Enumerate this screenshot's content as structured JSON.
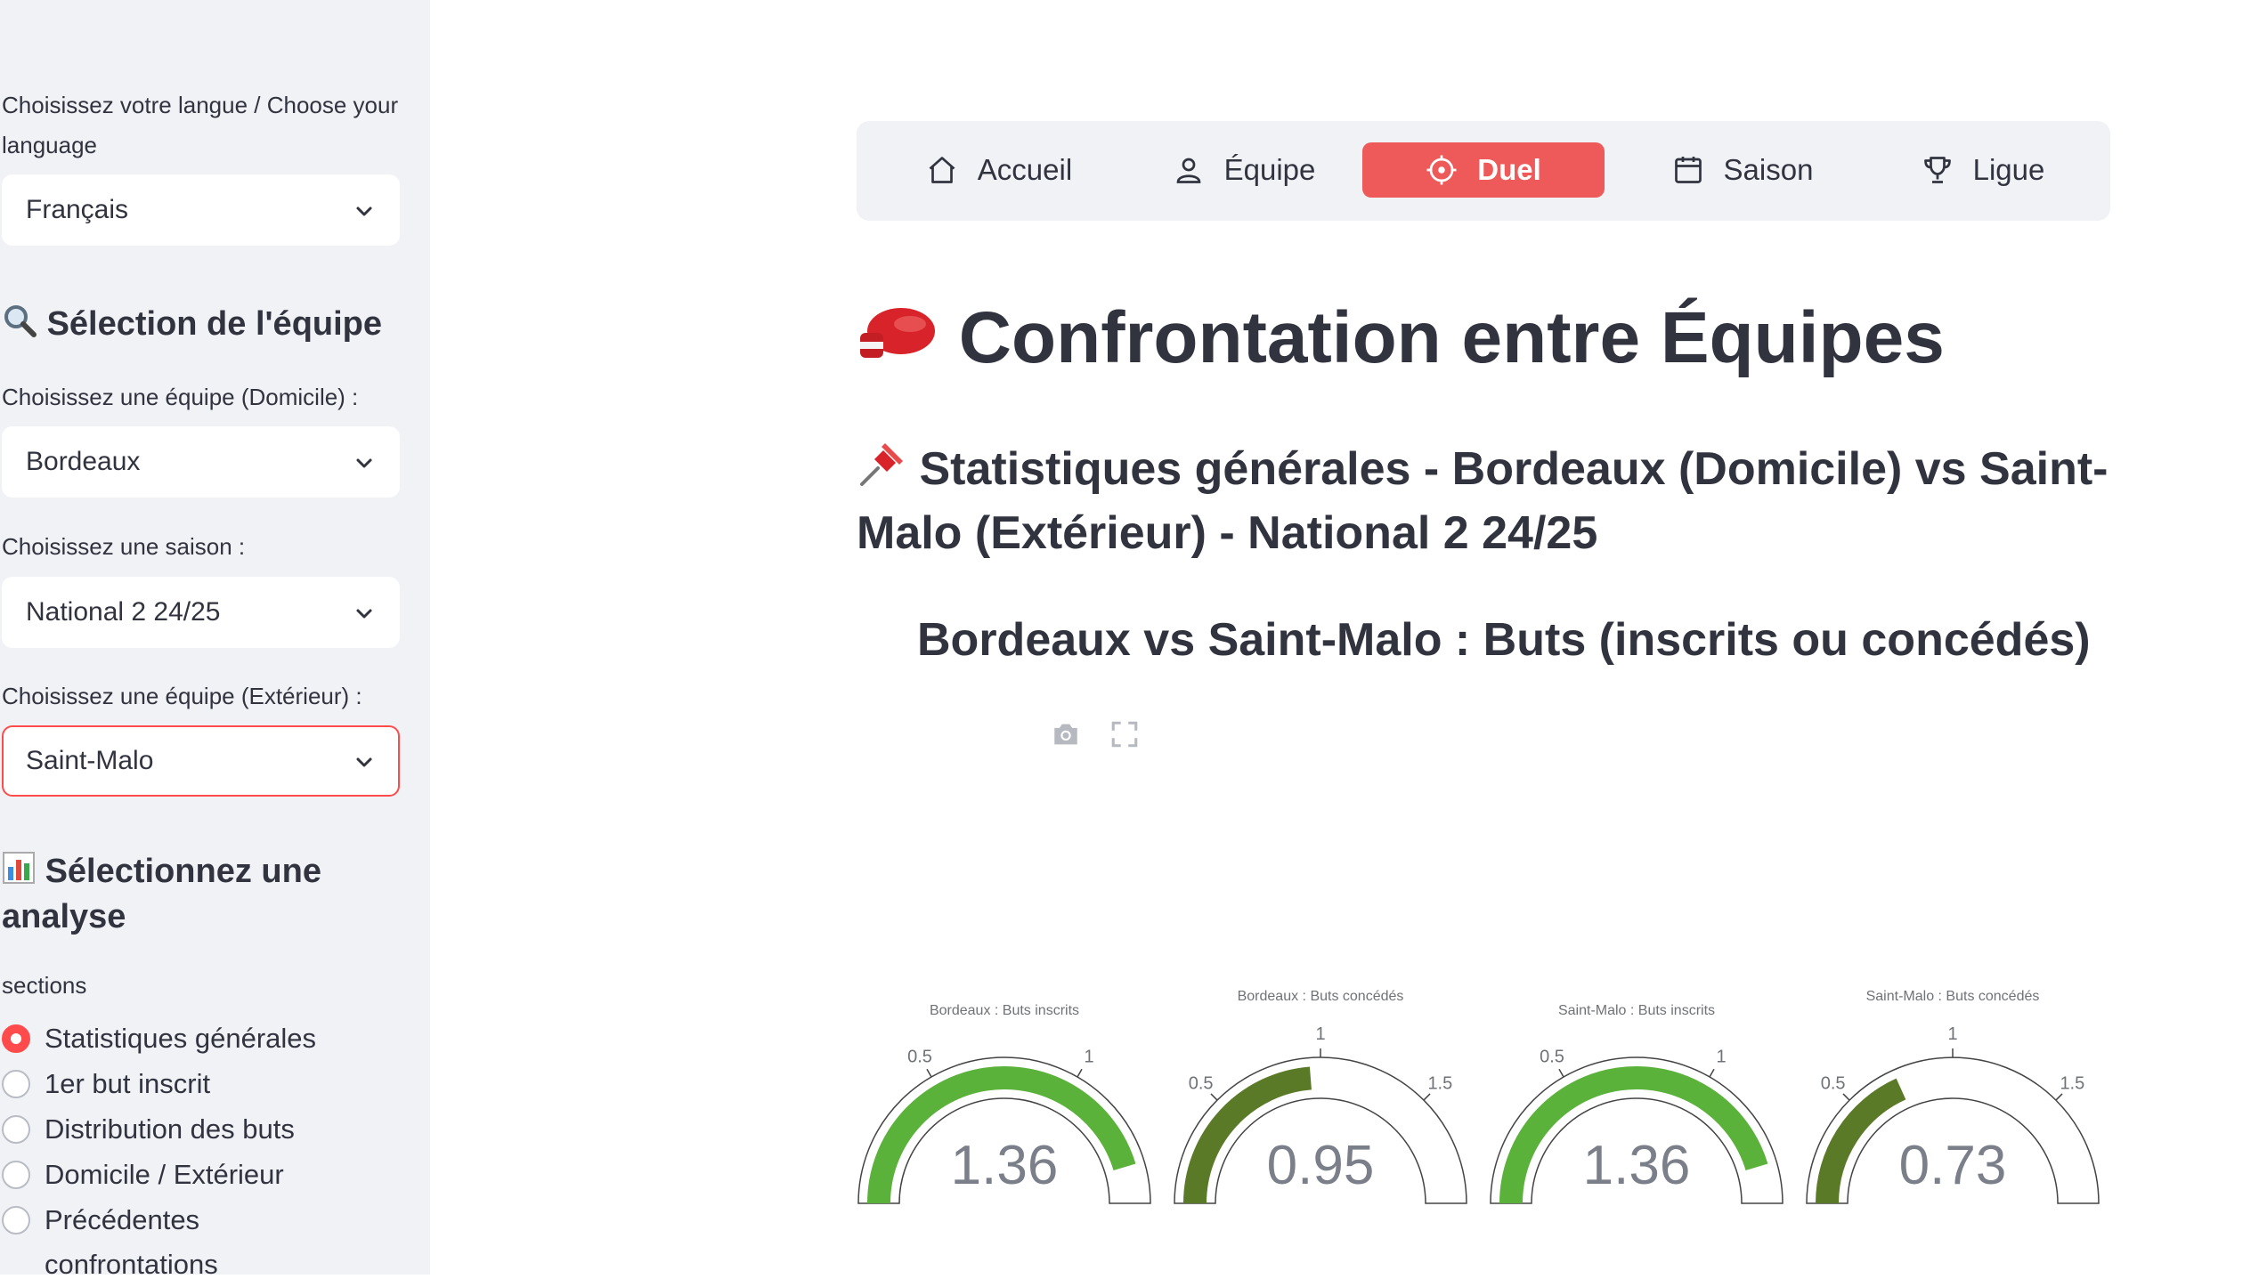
{
  "sidebar": {
    "language_label": "Choisissez votre langue / Choose your language",
    "language_value": "Français",
    "team_heading": "Sélection de l'équipe",
    "home_team_label": "Choisissez une équipe (Domicile) :",
    "home_team_value": "Bordeaux",
    "season_label": "Choisissez une saison :",
    "season_value": "National 2 24/25",
    "away_team_label": "Choisissez une équipe (Extérieur) :",
    "away_team_value": "Saint-Malo",
    "analysis_heading": "Sélectionnez une analyse",
    "sections_label": "sections",
    "sections": [
      {
        "label": "Statistiques générales",
        "checked": true
      },
      {
        "label": "1er but inscrit",
        "checked": false
      },
      {
        "label": "Distribution des buts",
        "checked": false
      },
      {
        "label": "Domicile / Extérieur",
        "checked": false
      },
      {
        "label": "Précédentes confrontations",
        "checked": false
      }
    ]
  },
  "nav": {
    "items": [
      {
        "label": "Accueil",
        "icon": "home-icon",
        "active": false
      },
      {
        "label": "Équipe",
        "icon": "user-icon",
        "active": false
      },
      {
        "label": "Duel",
        "icon": "target-icon",
        "active": true
      },
      {
        "label": "Saison",
        "icon": "calendar-icon",
        "active": false
      },
      {
        "label": "Ligue",
        "icon": "trophy-icon",
        "active": false
      }
    ],
    "active_color": "#ee5a5a"
  },
  "main": {
    "title": "Confrontation entre Équipes",
    "subtitle": "Statistiques générales - Bordeaux (Domicile) vs Saint-Malo (Extérieur) - National 2 24/25",
    "chart_title": "Bordeaux vs Saint-Malo : Buts (inscrits ou concédés)"
  },
  "chart_data": {
    "type": "gauge",
    "gauges": [
      {
        "title": "Bordeaux : Buts inscrits",
        "value": 1.36,
        "range": [
          0,
          1.5
        ],
        "ticks": [
          "0.5",
          "1"
        ],
        "color": "#5ab23a",
        "value_label": "1.36"
      },
      {
        "title": "Bordeaux : Buts concédés",
        "value": 0.95,
        "range": [
          0,
          2
        ],
        "ticks": [
          "0.5",
          "1",
          "1.5"
        ],
        "color": "#5b7a27",
        "value_label": "0.95"
      },
      {
        "title": "Saint-Malo : Buts inscrits",
        "value": 1.36,
        "range": [
          0,
          1.5
        ],
        "ticks": [
          "0.5",
          "1"
        ],
        "color": "#5ab23a",
        "value_label": "1.36"
      },
      {
        "title": "Saint-Malo : Buts concédés",
        "value": 0.73,
        "range": [
          0,
          2
        ],
        "ticks": [
          "0.5",
          "1",
          "1.5"
        ],
        "color": "#5b7a27",
        "value_label": "0.73"
      }
    ]
  }
}
